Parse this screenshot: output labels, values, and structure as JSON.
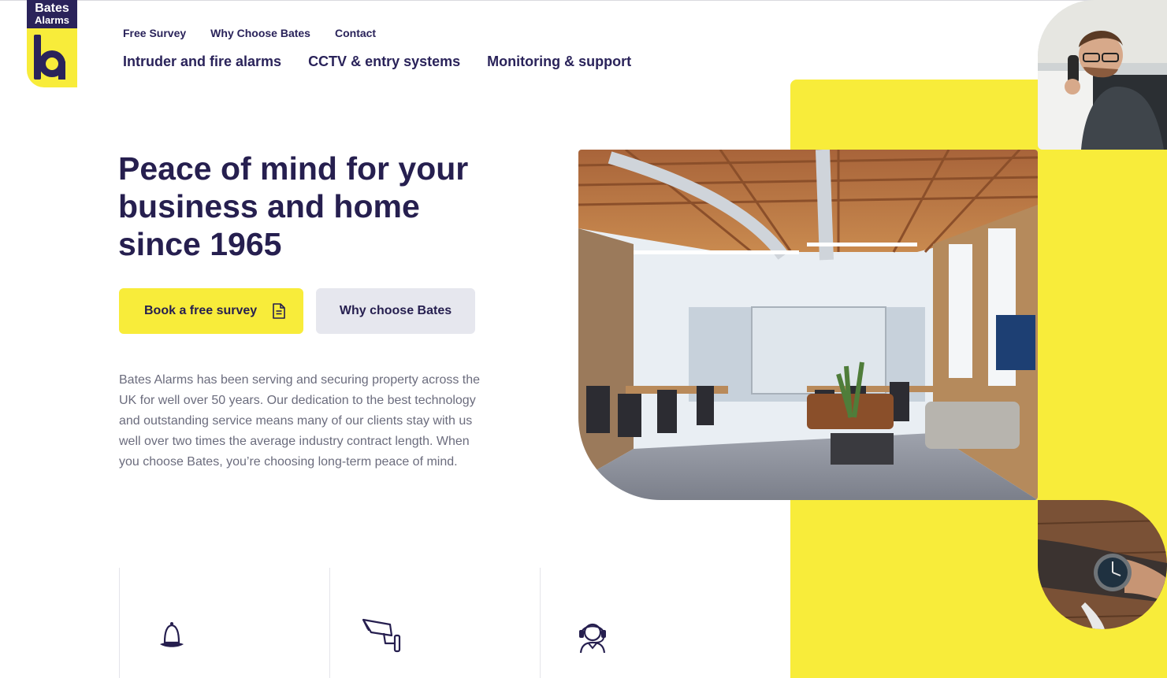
{
  "brand": {
    "line1": "Bates",
    "line2": "Alarms",
    "mark": "b"
  },
  "nav": {
    "secondary": [
      "Free Survey",
      "Why Choose Bates",
      "Contact"
    ],
    "primary": [
      "Intruder and fire alarms",
      "CCTV & entry systems",
      "Monitoring & support"
    ]
  },
  "hero": {
    "title": "Peace of mind for your business and home since 1965",
    "primary_button": "Book a free survey",
    "primary_button_icon": "document-icon",
    "secondary_button": "Why choose Bates",
    "intro": "Bates Alarms has been serving and securing property across the UK for well over 50 years. Our dedication to the best technology and outstanding service means many of our clients stay with us well over two times the average industry contract length. When you choose Bates, you’re choosing long-term peace of mind."
  },
  "features": [
    {
      "icon": "bell-icon"
    },
    {
      "icon": "cctv-camera-icon"
    },
    {
      "icon": "headset-support-icon"
    }
  ],
  "images": {
    "office": "open-plan office photo",
    "man": "man on phone photo",
    "watch": "wrist watch photo"
  },
  "colors": {
    "navy": "#261f4f",
    "yellow": "#f8ec3a",
    "light_gray": "#e6e7ee",
    "body_text": "#6b6c7d"
  }
}
